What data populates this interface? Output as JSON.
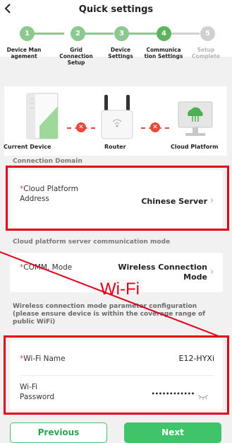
{
  "header": {
    "back_icon": "chevron-left-icon",
    "title": "Quick settings"
  },
  "steps": [
    {
      "number": "1",
      "label": "Device Man agement",
      "status": "done"
    },
    {
      "number": "2",
      "label": "Grid Connection Setup",
      "status": "done"
    },
    {
      "number": "3",
      "label": "Device Settings",
      "status": "done"
    },
    {
      "number": "4",
      "label": "Communica tion Settings",
      "status": "current"
    },
    {
      "number": "5",
      "label": "Setup Complete",
      "status": "pending"
    }
  ],
  "colors": {
    "accent": "#3fc46a",
    "step_done": "#8cc98f",
    "step_current": "#5bb55f",
    "step_pending": "#d0d0d0",
    "error": "#e64a3b",
    "annotation": "#e3001b"
  },
  "diagram": {
    "devices": [
      {
        "label": "Current Device",
        "icon": "inverter-icon"
      },
      {
        "label": "Router",
        "icon": "router-icon"
      },
      {
        "label": "Cloud Platform",
        "icon": "cloud-platform-icon"
      }
    ],
    "link_status_icon": "x-circle-icon"
  },
  "connection_domain": {
    "title": "Connection Domain",
    "label": "Cloud Platform Address",
    "value": "Chinese Server"
  },
  "comm_mode": {
    "title": "Cloud platform server communication mode",
    "label": "COMM. Mode",
    "value": "Wireless Connection Mode"
  },
  "annotation": {
    "text": "Wi-Fi"
  },
  "wireless_desc": "Wireless connection mode parameter configuration (please ensure device is within the coverage range of public WiFi)",
  "wifi": {
    "name_label": "Wi-Fi Name",
    "name_value": "E12-HYXi",
    "password_label": "Wi-Fi Password",
    "password_value": "••••••••••••",
    "eye_icon": "eye-closed-icon"
  },
  "buttons": {
    "previous": "Previous",
    "next": "Next"
  }
}
